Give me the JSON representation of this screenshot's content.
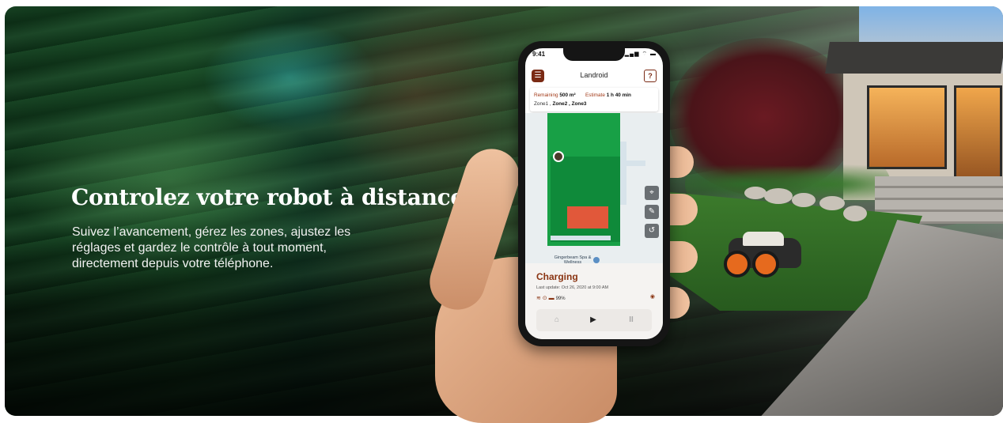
{
  "hero": {
    "headline": "Controlez votre robot à distance",
    "subtext": "Suivez l’avancement, gérez les zones, ajustez les réglages et gardez le contrôle à tout moment, directement depuis votre téléphone."
  },
  "phone": {
    "status_time": "9:41",
    "status_icons": "▂▄▆ ⌔ ▬",
    "app": {
      "menu_icon": "☰",
      "title": "Landroid",
      "help_icon": "?",
      "remaining_label": "Remaining",
      "remaining_value": "500 m²",
      "estimate_label": "Estimate",
      "estimate_value": "1 h 40 min",
      "zones": [
        "Zone1 ,",
        "Zone2 ,",
        "Zone3"
      ],
      "poi_label": "Gingerbeam Spa & Wellness",
      "map_buttons": [
        "⌖",
        "✎",
        "↺"
      ],
      "state": "Charging",
      "last_update": "Last update: Oct 26, 2020 at 9:00 AM",
      "indicators": "≋  ⊙  ▬",
      "battery": "99%",
      "vibrate_icon": "◉",
      "controls": {
        "home": "⌂",
        "play": "▶",
        "pause": "II"
      }
    }
  },
  "colors": {
    "accent": "#8a3412",
    "lawn": "#18a046",
    "house_on_map": "#e1583a"
  }
}
